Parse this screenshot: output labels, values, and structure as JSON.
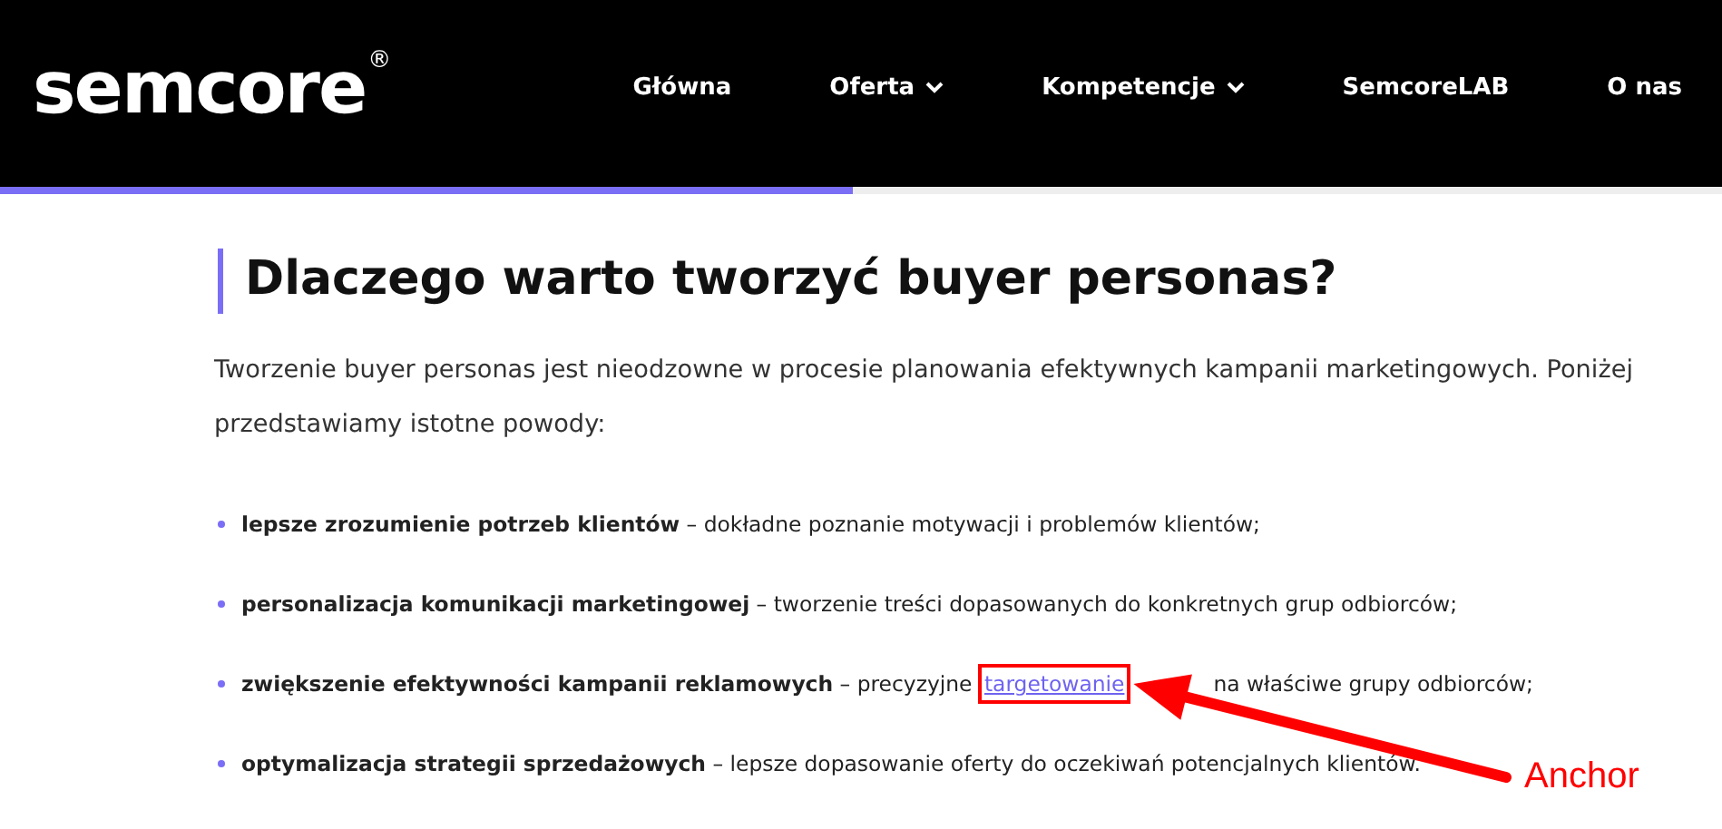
{
  "header": {
    "logo": "semcore",
    "logo_mark": "®",
    "nav": [
      {
        "label": "Główna",
        "has_dropdown": false
      },
      {
        "label": "Oferta",
        "has_dropdown": true
      },
      {
        "label": "Kompetencje",
        "has_dropdown": true
      },
      {
        "label": "SemcoreLAB",
        "has_dropdown": false
      },
      {
        "label": "O nas",
        "has_dropdown": false
      }
    ]
  },
  "reading_progress": {
    "level": 0.495
  },
  "article": {
    "heading": "Dlaczego warto tworzyć buyer personas?",
    "intro": "Tworzenie buyer personas jest nieodzowne w procesie planowania efektywnych kampanii marketingowych. Poniżej przedstawiamy istotne powody:",
    "bullets": [
      {
        "term": "lepsze zrozumienie potrzeb klientów",
        "text": " – dokładne poznanie motywacji i problemów klientów;"
      },
      {
        "term": "personalizacja komunikacji marketingowej",
        "text": " – tworzenie treści dopasowanych do konkretnych grup odbiorców;"
      },
      {
        "term": "zwiększenie efektywności kampanii reklamowych",
        "text": " – precyzyjne ",
        "link": "targetowanie",
        "link_highlighted": true,
        "after": "na właściwe grupy odbiorców;"
      },
      {
        "term": "optymalizacja strategii sprzedażowych",
        "text": " – lepsze dopasowanie oferty do oczekiwań potencjalnych klientów."
      }
    ]
  },
  "annotation": {
    "label": "Anchor"
  }
}
